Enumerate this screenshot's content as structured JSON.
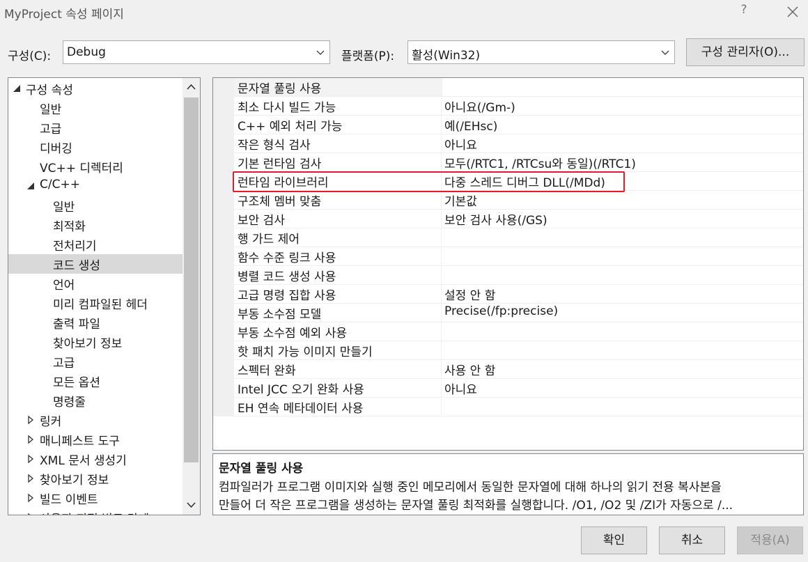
{
  "window": {
    "title": "MyProject 속성 페이지",
    "help_label": "?"
  },
  "toolbar": {
    "config_label": "구성(C):",
    "config_value": "Debug",
    "platform_label": "플랫폼(P):",
    "platform_value": "활성(Win32)",
    "config_manager_label": "구성 관리자(O)..."
  },
  "tree": {
    "items": [
      {
        "label": "구성 속성",
        "expanded": true
      },
      {
        "label": "일반"
      },
      {
        "label": "고급"
      },
      {
        "label": "디버깅"
      },
      {
        "label": "VC++ 디렉터리"
      },
      {
        "label": "C/C++",
        "expanded": true
      },
      {
        "label": "일반"
      },
      {
        "label": "최적화"
      },
      {
        "label": "전처리기"
      },
      {
        "label": "코드 생성",
        "selected": true
      },
      {
        "label": "언어"
      },
      {
        "label": "미리 컴파일된 헤더"
      },
      {
        "label": "출력 파일"
      },
      {
        "label": "찾아보기 정보"
      },
      {
        "label": "고급"
      },
      {
        "label": "모든 옵션"
      },
      {
        "label": "명령줄"
      },
      {
        "label": "링커",
        "expanded": false
      },
      {
        "label": "매니페스트 도구",
        "expanded": false
      },
      {
        "label": "XML 문서 생성기",
        "expanded": false
      },
      {
        "label": "찾아보기 정보",
        "expanded": false
      },
      {
        "label": "빌드 이벤트",
        "expanded": false
      },
      {
        "label": "사용자 지정 빌드 단계",
        "expanded": false
      }
    ]
  },
  "properties": [
    {
      "name": "문자열 풀링 사용",
      "value": ""
    },
    {
      "name": "최소 다시 빌드 가능",
      "value": "아니요(/Gm-)"
    },
    {
      "name": "C++ 예외 처리 가능",
      "value": "예(/EHsc)"
    },
    {
      "name": "작은 형식 검사",
      "value": "아니요"
    },
    {
      "name": "기본 런타임 검사",
      "value": "모두(/RTC1, /RTCsu와 동일)(/RTC1)"
    },
    {
      "name": "런타임 라이브러리",
      "value": "다중 스레드 디버그 DLL(/MDd)",
      "highlighted": true
    },
    {
      "name": "구조체 멤버 맞춤",
      "value": "기본값"
    },
    {
      "name": "보안 검사",
      "value": "보안 검사 사용(/GS)"
    },
    {
      "name": "행 가드 제어",
      "value": ""
    },
    {
      "name": "함수 수준 링크 사용",
      "value": ""
    },
    {
      "name": "병렬 코드 생성 사용",
      "value": ""
    },
    {
      "name": "고급 명령 집합 사용",
      "value": "설정 안 함"
    },
    {
      "name": "부동 소수점 모델",
      "value": "Precise(/fp:precise)"
    },
    {
      "name": "부동 소수점 예외 사용",
      "value": ""
    },
    {
      "name": "핫 패치 가능 이미지 만들기",
      "value": ""
    },
    {
      "name": "스펙터 완화",
      "value": "사용 안 함"
    },
    {
      "name": "Intel JCC 오기 완화 사용",
      "value": "아니요"
    },
    {
      "name": "EH 연속 메타데이터 사용",
      "value": ""
    }
  ],
  "description": {
    "title": "문자열 풀링 사용",
    "line1": "컴파일러가 프로그램 이미지와 실행 중인 메모리에서 동일한 문자열에 대해 하나의 읽기 전용 복사본을",
    "line2": "만들어 더 작은 프로그램을 생성하는 문자열 풀링 최적화를 실행합니다. /O1, /O2 및 /ZI가 자동으로 /..."
  },
  "buttons": {
    "ok": "확인",
    "cancel": "취소",
    "apply": "적용(A)"
  },
  "colors": {
    "highlight_border": "#e11d2b",
    "selection": "#d9d9d9",
    "dialog_bg": "#f0f0f0"
  }
}
